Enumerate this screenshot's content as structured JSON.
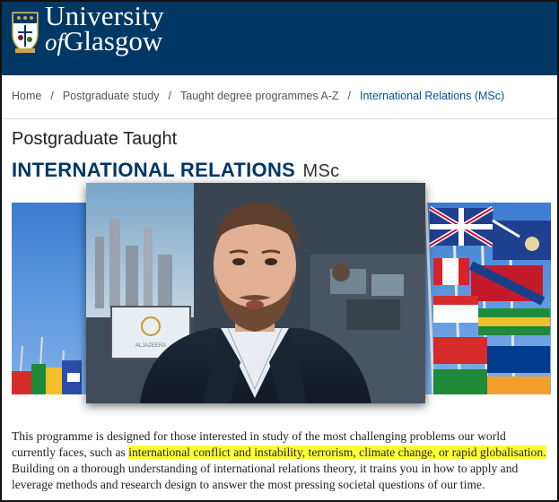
{
  "header": {
    "brand_line1": "University",
    "brand_of": "of",
    "brand_line2": "Glasgow",
    "background": "#003865"
  },
  "breadcrumb": {
    "items": [
      {
        "label": "Home"
      },
      {
        "label": "Postgraduate study"
      },
      {
        "label": "Taught degree programmes A-Z"
      }
    ],
    "separator": "/",
    "current": "International Relations (MSc)"
  },
  "page": {
    "subtitle": "Postgraduate Taught",
    "title": "INTERNATIONAL RELATIONS",
    "degree": "MSc"
  },
  "video": {
    "screen_logo": "ALJAZEERA"
  },
  "description": {
    "part1": "This programme is designed for those interested in study of the most challenging problems our world currently faces, such as ",
    "highlight": "international conflict and instability, terrorism, climate change, or rapid globalisation.",
    "part2": " Building on a thorough understanding of international relations theory, it trains you in how to apply and leverage methods and research design to answer the most pressing societal questions of our time.",
    "highlight_color": "#ffff33"
  },
  "icons": {
    "crest": "university-crest-icon"
  }
}
